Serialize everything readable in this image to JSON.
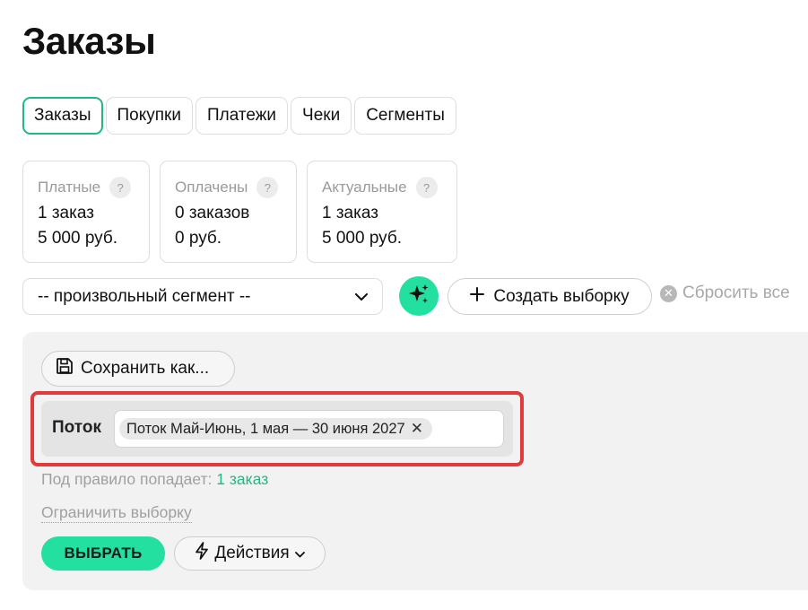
{
  "page": {
    "title": "Заказы"
  },
  "tabs": [
    {
      "label": "Заказы",
      "active": true
    },
    {
      "label": "Покупки",
      "active": false
    },
    {
      "label": "Платежи",
      "active": false
    },
    {
      "label": "Чеки",
      "active": false
    },
    {
      "label": "Сегменты",
      "active": false
    }
  ],
  "stats": [
    {
      "title": "Платные",
      "help": "?",
      "count": "1 заказ",
      "amount": "5 000 руб."
    },
    {
      "title": "Оплачены",
      "help": "?",
      "count": "0 заказов",
      "amount": "0 руб."
    },
    {
      "title": "Актуальные",
      "help": "?",
      "count": "1 заказ",
      "amount": "5 000 руб."
    }
  ],
  "toolbar": {
    "segment_value": "-- произвольный сегмент --",
    "create_label": "Создать выборку",
    "reset_label": "Сбросить все"
  },
  "panel": {
    "save_label": "Сохранить как...",
    "filter_label": "Поток",
    "filter_chip": "Поток Май-Июнь, 1 мая — 30 июня 2027",
    "match_prefix": "Под правило попадает:",
    "match_count": "1 заказ",
    "limit_label": "Ограничить выборку",
    "select_label": "ВЫБРАТЬ",
    "actions_label": "Действия"
  },
  "colors": {
    "accent": "#23e0a0",
    "accent_text": "#1fb889",
    "highlight": "#e03a3a"
  },
  "icons": {
    "magic": "sparkles-icon",
    "create": "plus-icon",
    "reset": "close-circle-icon",
    "save": "floppy-disk-icon",
    "chip_remove": "close-icon",
    "actions": "lightning-icon",
    "dropdown": "chevron-down-icon"
  }
}
